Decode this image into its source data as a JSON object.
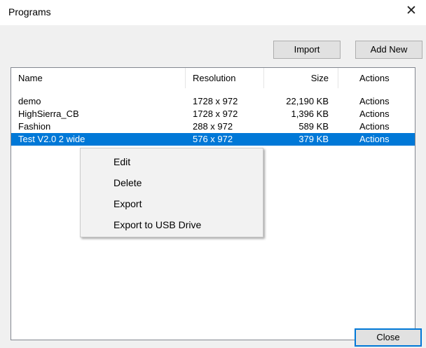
{
  "window": {
    "title": "Programs",
    "close_glyph": "✕"
  },
  "toolbar": {
    "import_label": "Import",
    "add_new_label": "Add New"
  },
  "list": {
    "columns": [
      "Name",
      "Resolution",
      "Size",
      "Actions"
    ],
    "rows": [
      {
        "name": "demo",
        "resolution": "1728 x 972",
        "size": "22,190 KB",
        "actions": "Actions"
      },
      {
        "name": "HighSierra_CB",
        "resolution": "1728 x 972",
        "size": "1,396 KB",
        "actions": "Actions"
      },
      {
        "name": "Fashion",
        "resolution": "288 x 972",
        "size": "589 KB",
        "actions": "Actions"
      },
      {
        "name": "Test V2.0 2 wide",
        "resolution": "576 x 972",
        "size": "379 KB",
        "actions": "Actions",
        "selected": true
      }
    ]
  },
  "context_menu": {
    "items": [
      "Edit",
      "Delete",
      "Export",
      "Export to USB Drive"
    ]
  },
  "footer": {
    "close_label": "Close"
  },
  "colors": {
    "selection": "#0078d7",
    "dialog_background": "#f0f0f0"
  }
}
